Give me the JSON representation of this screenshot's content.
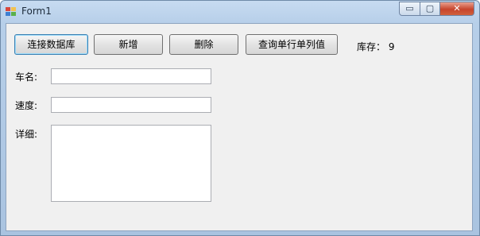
{
  "window": {
    "title": "Form1"
  },
  "titlebar_controls": {
    "min": "▭",
    "max": "▢",
    "close": "✕"
  },
  "toolbar": {
    "connect_label": "连接数据库",
    "add_label": "新增",
    "delete_label": "删除",
    "query_label": "查询单行单列值",
    "stock_label": "库存：",
    "stock_value": "9"
  },
  "form": {
    "name_label": "车名:",
    "speed_label": "速度:",
    "detail_label": "详细:",
    "name_value": "",
    "speed_value": "",
    "detail_value": ""
  }
}
